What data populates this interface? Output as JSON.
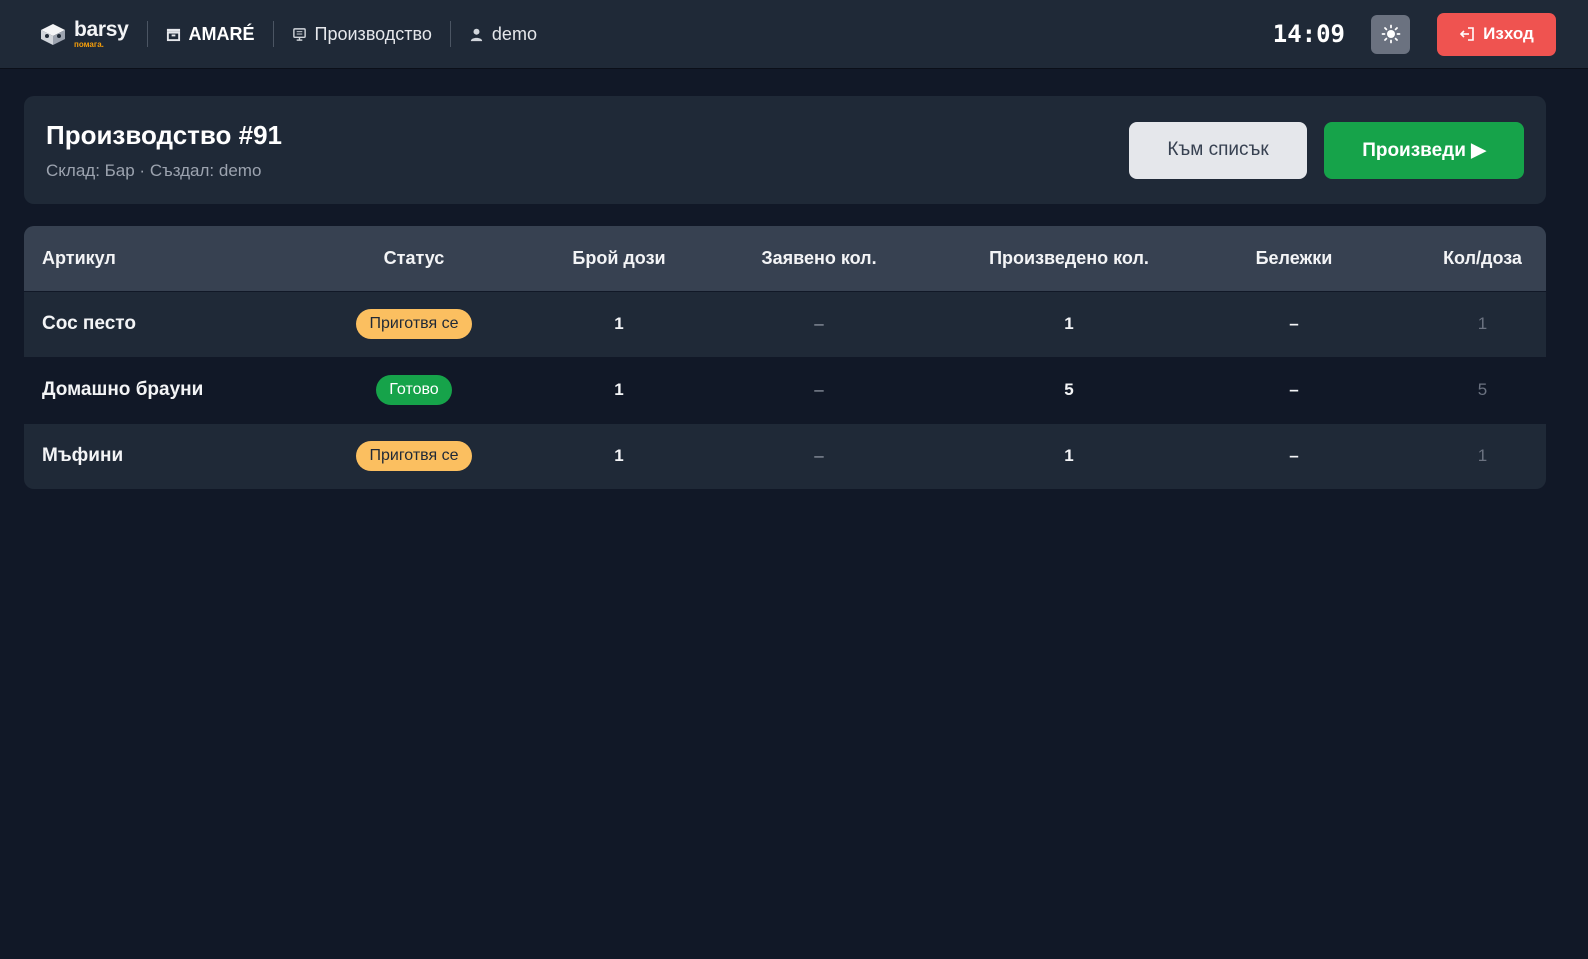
{
  "topbar": {
    "brand_name": "barsy",
    "brand_tag": "помага.",
    "venue": "AMARÉ",
    "section": "Производство",
    "user": "demo",
    "clock": "14:09",
    "logout_label": "Изход",
    "accent_logout": "#ef5350"
  },
  "header": {
    "title": "Производство #91",
    "subtitle": "Склад: Бар · Създал: demo",
    "list_button": "Към списък",
    "produce_button": "Произведи ▶"
  },
  "table": {
    "columns": [
      "Артикул",
      "Статус",
      "Брой дози",
      "Заявено кол.",
      "Произведено кол.",
      "Бележки",
      "Кол/доза"
    ],
    "rows": [
      {
        "item": "Сос песто",
        "status": "Приготвя се",
        "doses": "1",
        "requested": "–",
        "produced": "1",
        "notes": "–",
        "per_dose": "1"
      },
      {
        "item": "Домашно брауни",
        "status": "Готово",
        "doses": "1",
        "requested": "–",
        "produced": "5",
        "notes": "–",
        "per_dose": "5"
      },
      {
        "item": "Мъфини",
        "status": "Приготвя се",
        "doses": "1",
        "requested": "–",
        "produced": "1",
        "notes": "–",
        "per_dose": "1"
      }
    ]
  },
  "colors": {
    "status_preparing": "#fbbf60",
    "status_done": "#16a34a",
    "produce_button": "#16a34a"
  }
}
